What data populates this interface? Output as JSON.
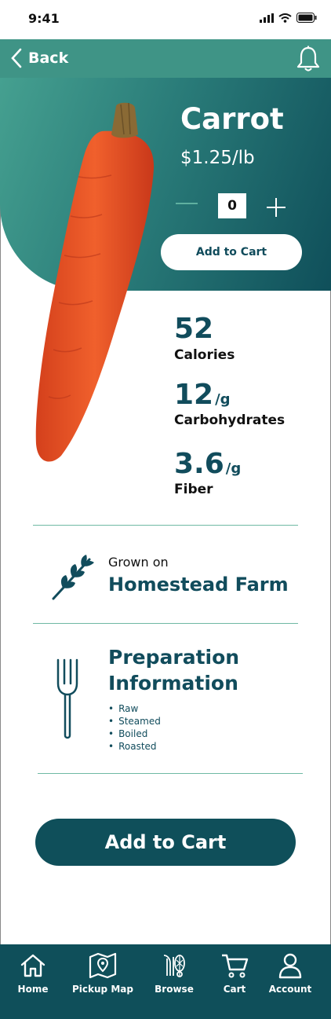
{
  "status_bar": {
    "time": "9:41"
  },
  "header": {
    "back_label": "Back"
  },
  "product": {
    "name": "Carrot",
    "price": "$1.25/lb",
    "quantity": "0",
    "add_to_cart_small": "Add to Cart"
  },
  "nutrition": [
    {
      "value": "52",
      "unit": "",
      "label": "Calories"
    },
    {
      "value": "12",
      "unit": "/g",
      "label": "Carbohydrates"
    },
    {
      "value": "3.6",
      "unit": "/g",
      "label": "Fiber"
    }
  ],
  "farm": {
    "prefix": "Grown on",
    "name": "Homestead Farm"
  },
  "preparation": {
    "title": "Preparation Information",
    "items": [
      "Raw",
      "Steamed",
      "Boiled",
      "Roasted"
    ]
  },
  "cta": {
    "label": "Add to Cart"
  },
  "nav": [
    {
      "label": "Home",
      "icon": "home-icon"
    },
    {
      "label": "Pickup Map",
      "icon": "map-icon"
    },
    {
      "label": "Browse",
      "icon": "browse-icon"
    },
    {
      "label": "Cart",
      "icon": "cart-icon"
    },
    {
      "label": "Account",
      "icon": "account-icon"
    }
  ],
  "colors": {
    "teal_light": "#3f9486",
    "teal_dark": "#0f4f5a",
    "text_dark": "#114c5c",
    "carrot": "#e8502b"
  }
}
